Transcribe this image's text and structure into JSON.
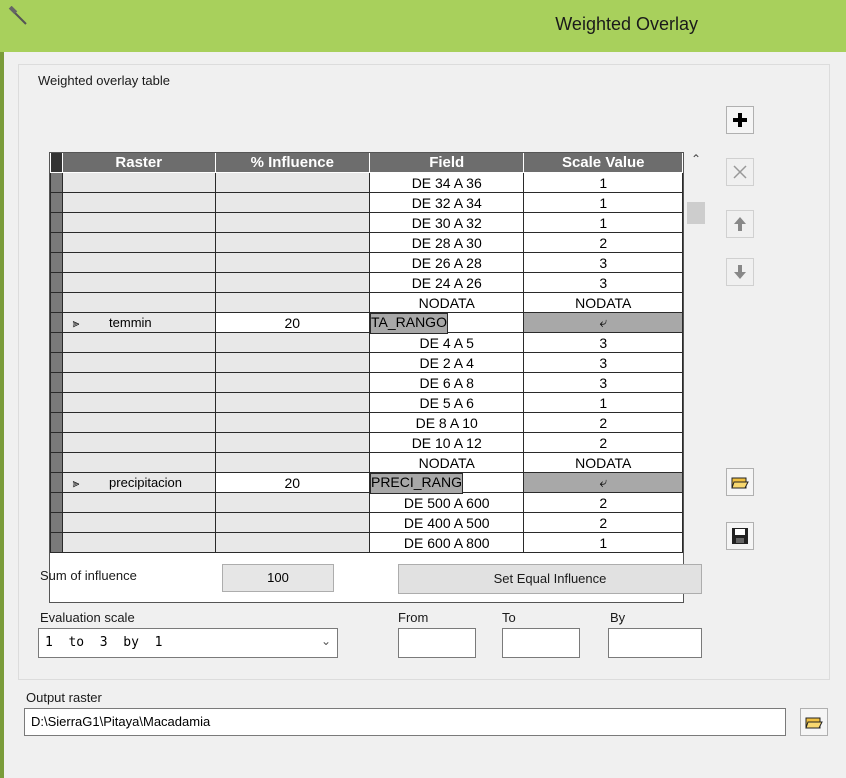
{
  "window": {
    "title": "Weighted Overlay"
  },
  "table_label": "Weighted overlay table",
  "columns": [
    "Raster",
    "% Influence",
    "Field",
    "Scale Value"
  ],
  "rows": [
    {
      "type": "value",
      "field": "DE 34 A 36",
      "scale": "1"
    },
    {
      "type": "value",
      "field": "DE 32 A 34",
      "scale": "1"
    },
    {
      "type": "value",
      "field": "DE 30 A 32",
      "scale": "1"
    },
    {
      "type": "value",
      "field": "DE 28 A 30",
      "scale": "2"
    },
    {
      "type": "value",
      "field": "DE 26 A 28",
      "scale": "3"
    },
    {
      "type": "value",
      "field": "DE 24 A 26",
      "scale": "3"
    },
    {
      "type": "value",
      "field": "NODATA",
      "scale": "NODATA"
    },
    {
      "type": "raster",
      "raster": "temmin",
      "influence": "20",
      "field": "TA_RANGO",
      "scale": ""
    },
    {
      "type": "value",
      "field": "DE 4 A 5",
      "scale": "3"
    },
    {
      "type": "value",
      "field": "DE 2 A 4",
      "scale": "3"
    },
    {
      "type": "value",
      "field": "DE 6 A 8",
      "scale": "3"
    },
    {
      "type": "value",
      "field": "DE 5 A 6",
      "scale": "1"
    },
    {
      "type": "value",
      "field": "DE 8 A 10",
      "scale": "2"
    },
    {
      "type": "value",
      "field": "DE 10 A 12",
      "scale": "2"
    },
    {
      "type": "value",
      "field": "NODATA",
      "scale": "NODATA"
    },
    {
      "type": "raster",
      "raster": "precipitacion",
      "influence": "20",
      "field": "PRECI_RANG",
      "scale": ""
    },
    {
      "type": "value",
      "field": "DE 500 A 600",
      "scale": "2"
    },
    {
      "type": "value",
      "field": "DE 400 A 500",
      "scale": "2"
    },
    {
      "type": "value",
      "field": "DE 600 A 800",
      "scale": "1"
    }
  ],
  "sum_label": "Sum of influence",
  "sum_value": "100",
  "set_equal_label": "Set Equal Influence",
  "eval_label": "Evaluation scale",
  "eval_value": "1  to  3  by  1",
  "from_label": "From",
  "to_label": "To",
  "by_label": "By",
  "output_label": "Output raster",
  "output_value": "D:\\SierraG1\\Pitaya\\Macadamia",
  "icons": {
    "add": "plus-icon",
    "remove": "x-icon",
    "up": "arrow-up-icon",
    "down": "arrow-down-icon",
    "open": "folder-open-icon",
    "save": "save-icon",
    "expand": "double-chevron-up-icon",
    "scale_dropdown": "undo-arrow-icon"
  }
}
